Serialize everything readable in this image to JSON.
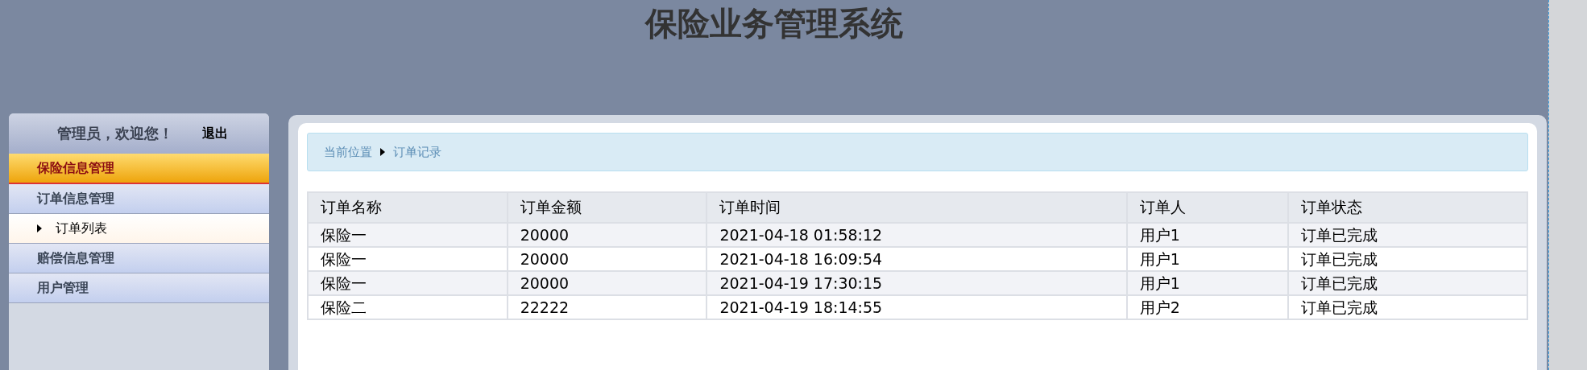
{
  "header": {
    "title": "保险业务管理系统"
  },
  "sidebar": {
    "greeting": "管理员，欢迎您！",
    "logout": "退出",
    "items": [
      {
        "kind": "group",
        "label": "保险信息管理",
        "selected": true
      },
      {
        "kind": "group",
        "label": "订单信息管理",
        "selected": false
      },
      {
        "kind": "item",
        "label": "订单列表",
        "selected": false
      },
      {
        "kind": "group",
        "label": "赔偿信息管理",
        "selected": false
      },
      {
        "kind": "group",
        "label": "用户管理",
        "selected": false
      }
    ]
  },
  "breadcrumb": [
    "当前位置",
    "订单记录"
  ],
  "table": {
    "columns": [
      "订单名称",
      "订单金额",
      "订单时间",
      "订单人",
      "订单状态"
    ],
    "rows": [
      [
        "保险一",
        "20000",
        "2021-04-18 01:58:12",
        "用户1",
        "订单已完成"
      ],
      [
        "保险一",
        "20000",
        "2021-04-18 16:09:54",
        "用户1",
        "订单已完成"
      ],
      [
        "保险一",
        "20000",
        "2021-04-19 17:30:15",
        "用户1",
        "订单已完成"
      ],
      [
        "保险二",
        "22222",
        "2021-04-19 18:14:55",
        "用户2",
        "订单已完成"
      ]
    ]
  }
}
